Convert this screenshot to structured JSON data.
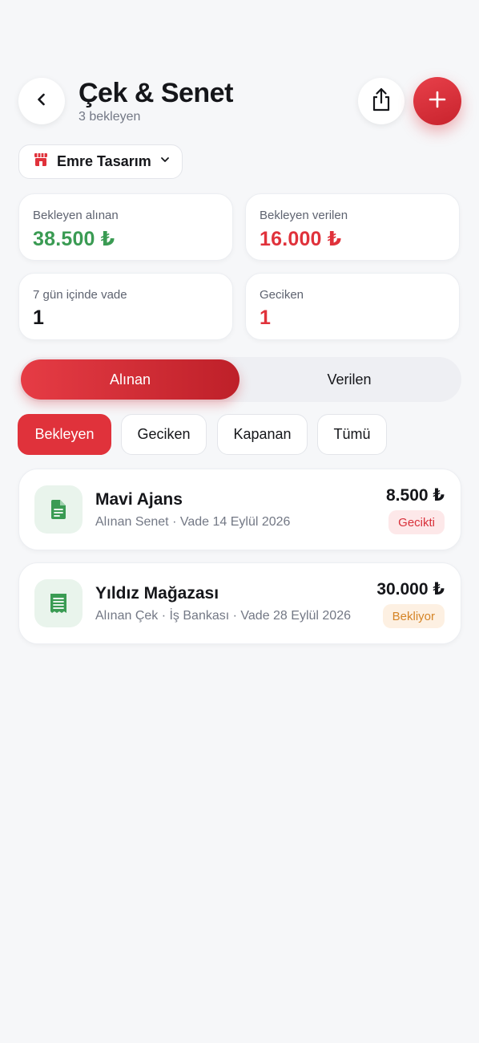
{
  "header": {
    "title": "Çek & Senet",
    "subtitle": "3 bekleyen"
  },
  "business": {
    "name": "Emre Tasarım"
  },
  "stats": [
    {
      "label": "Bekleyen alınan",
      "value": "38.500 ₺",
      "color": "#3a9b53"
    },
    {
      "label": "Bekleyen verilen",
      "value": "16.000 ₺",
      "color": "#e0323b"
    },
    {
      "label": "7 gün içinde vade",
      "value": "1",
      "color": "#15161a"
    },
    {
      "label": "Geciken",
      "value": "1",
      "color": "#e0323b"
    }
  ],
  "segment": {
    "active": "Alınan",
    "inactive": "Verilen"
  },
  "filters": [
    {
      "label": "Bekleyen",
      "active": true
    },
    {
      "label": "Geciken",
      "active": false
    },
    {
      "label": "Kapanan",
      "active": false
    },
    {
      "label": "Tümü",
      "active": false
    }
  ],
  "items": [
    {
      "title": "Mavi Ajans",
      "subtitle": "Alınan Senet · Vade 14 Eylül 2026",
      "amount": "8.500 ₺",
      "status": "Gecikti",
      "icon": "document-icon"
    },
    {
      "title": "Yıldız Mağazası",
      "subtitle": "Alınan Çek · İş Bankası · Vade 28 Eylül 2026",
      "amount": "30.000 ₺",
      "status": "Bekliyor",
      "icon": "receipt-icon"
    }
  ],
  "colors": {
    "accent": "#e0323b",
    "positive": "#3a9b53",
    "warning": "#d58426",
    "background": "#f6f7f9"
  }
}
